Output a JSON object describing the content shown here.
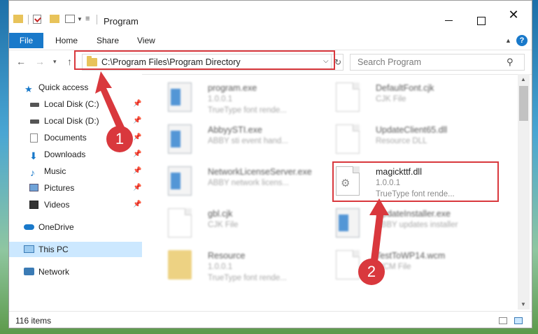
{
  "window": {
    "title": "Program"
  },
  "ribbon": {
    "file": "File",
    "tabs": [
      "Home",
      "Share",
      "View"
    ],
    "help": "?"
  },
  "address": {
    "path": "C:\\Program Files\\Program Directory",
    "search_placeholder": "Search Program"
  },
  "nav": {
    "items": [
      {
        "label": "Quick access",
        "icon": "star-icon",
        "pinned": false
      },
      {
        "label": "Local Disk (C:)",
        "icon": "drive-icon",
        "pinned": true
      },
      {
        "label": "Local Disk (D:)",
        "icon": "drive-icon",
        "pinned": true
      },
      {
        "label": "Documents",
        "icon": "documents-icon",
        "pinned": true
      },
      {
        "label": "Downloads",
        "icon": "download-icon",
        "pinned": true
      },
      {
        "label": "Music",
        "icon": "music-icon",
        "pinned": true
      },
      {
        "label": "Pictures",
        "icon": "pictures-icon",
        "pinned": true
      },
      {
        "label": "Videos",
        "icon": "videos-icon",
        "pinned": true
      },
      {
        "label": "OneDrive",
        "icon": "cloud-icon",
        "pinned": false
      },
      {
        "label": "This PC",
        "icon": "computer-icon",
        "pinned": false
      },
      {
        "label": "Network",
        "icon": "network-icon",
        "pinned": false
      }
    ]
  },
  "files": [
    {
      "name": "program.exe",
      "line2": "1.0.0.1",
      "line3": "TrueType font rende..."
    },
    {
      "name": "DefaultFont.cjk",
      "line2": "CJK File",
      "line3": ""
    },
    {
      "name": "AbbyySTI.exe",
      "line2": "ABBY sti event hand...",
      "line3": ""
    },
    {
      "name": "UpdateClient65.dll",
      "line2": "Resource DLL",
      "line3": ""
    },
    {
      "name": "NetworkLicenseServer.exe",
      "line2": "ABBY network licens...",
      "line3": ""
    },
    {
      "name": "magickttf.dll",
      "line2": "1.0.0.1",
      "line3": "TrueType font rende..."
    },
    {
      "name": "gbl.cjk",
      "line2": "CJK File",
      "line3": ""
    },
    {
      "name": "UpdateInstaller.exe",
      "line2": "ABBY updates installer",
      "line3": ""
    },
    {
      "name": "Resource",
      "line2": "1.0.0.1",
      "line3": "TrueType font rende..."
    },
    {
      "name": "TestToWP14.wcm",
      "line2": "WCM File",
      "line3": ""
    }
  ],
  "status": {
    "count": "116 items"
  },
  "callouts": {
    "one": "1",
    "two": "2"
  },
  "colors": {
    "accent": "#1979ca",
    "highlight": "#d9383d",
    "selection": "#cce8ff"
  }
}
